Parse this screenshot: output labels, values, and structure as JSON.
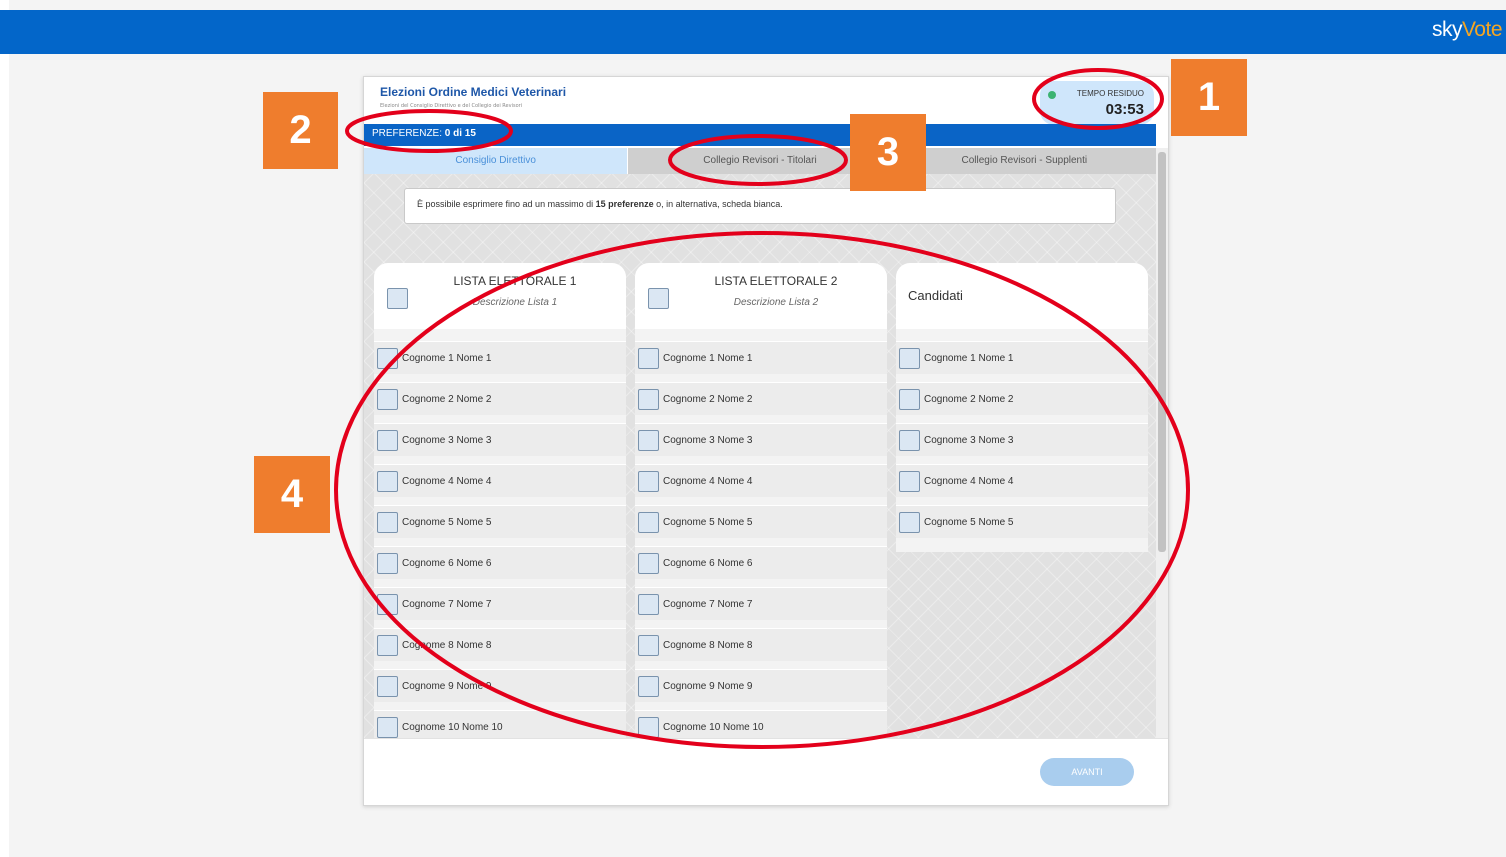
{
  "brand": {
    "part1": "sky",
    "part2": "Vote"
  },
  "election": {
    "title": "Elezioni Ordine Medici Veterinari",
    "subtitle": "Elezioni del Consiglio Direttivo e del Collegio dei Revisori"
  },
  "timer": {
    "label": "TEMPO RESIDUO",
    "value": "03:53"
  },
  "preferences": {
    "label": "PREFERENZE:",
    "count": "0 di 15"
  },
  "tabs": [
    {
      "label": "Consiglio Direttivo",
      "active": true
    },
    {
      "label": "Collegio Revisori - Titolari",
      "active": false
    },
    {
      "label": "Collegio Revisori - Supplenti",
      "active": false
    }
  ],
  "info": {
    "pre": "È possibile esprimere fino ad un massimo di ",
    "bold": "15 preferenze",
    "post": " o, in alternativa, scheda bianca."
  },
  "lists": [
    {
      "title": "LISTA ELETTORALE 1",
      "description": "Descrizione Lista 1",
      "candidates": [
        "Cognome 1 Nome 1",
        "Cognome 2 Nome 2",
        "Cognome 3 Nome 3",
        "Cognome 4 Nome 4",
        "Cognome 5 Nome 5",
        "Cognome 6 Nome 6",
        "Cognome 7 Nome 7",
        "Cognome 8 Nome 8",
        "Cognome 9 Nome 9",
        "Cognome 10 Nome 10"
      ]
    },
    {
      "title": "LISTA ELETTORALE 2",
      "description": "Descrizione Lista 2",
      "candidates": [
        "Cognome 1 Nome 1",
        "Cognome 2 Nome 2",
        "Cognome 3 Nome 3",
        "Cognome 4 Nome 4",
        "Cognome 5 Nome 5",
        "Cognome 6 Nome 6",
        "Cognome 7 Nome 7",
        "Cognome 8 Nome 8",
        "Cognome 9 Nome 9",
        "Cognome 10 Nome 10"
      ]
    }
  ],
  "candidati": {
    "title": "Candidati",
    "candidates": [
      "Cognome 1 Nome 1",
      "Cognome 2 Nome 2",
      "Cognome 3 Nome 3",
      "Cognome 4 Nome 4",
      "Cognome 5 Nome 5"
    ]
  },
  "footer": {
    "next_label": "AVANTI"
  },
  "annotations": [
    "1",
    "2",
    "3",
    "4"
  ],
  "colors": {
    "topbar": "#0366c9",
    "badge": "#ef7d2d",
    "ellipse": "#e3001b",
    "accent": "#0a64c6"
  }
}
